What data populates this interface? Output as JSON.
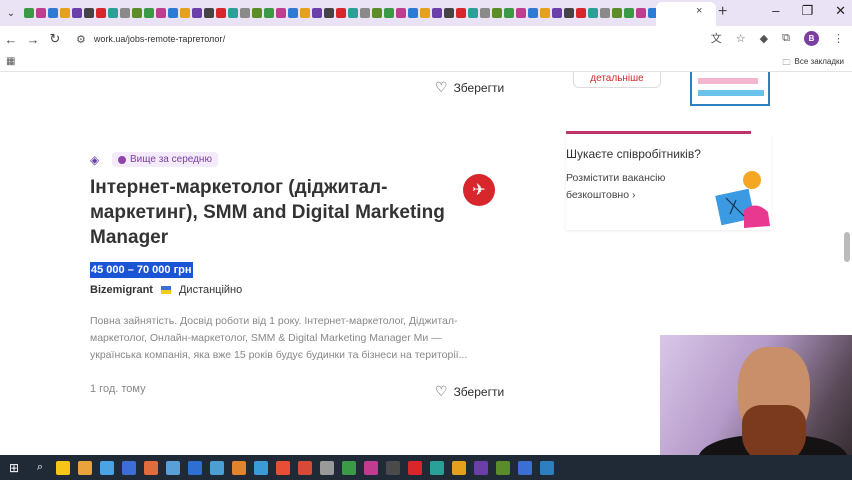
{
  "browser": {
    "tab_close": "×",
    "tab_new": "+",
    "url": "work.ua/jobs-remote-таргетолог/",
    "avatar_letter": "B",
    "all_bookmarks": "Все закладки"
  },
  "listing_top": {
    "save_label": "Зберегти"
  },
  "job": {
    "badge_label": "Вище за середню",
    "title": "Інтернет-маркетолог (діджитал-маркетинг), SMM and Digital Marketing Manager",
    "salary": "45 000 – 70 000 грн",
    "company": "Bizemigrant",
    "work_mode": "Дистанційно",
    "description": "Повна зайнятість. Досвід роботи від 1 року. Інтернет-маркетолог, Діджитал-маркетолог, Онлайн-маркетолог, SMM & Digital Marketing Manager Ми — українська компанія, яка вже 15 років будує будинки та бізнеси на території...",
    "posted": "1 год. тому",
    "save_label": "Зберегти"
  },
  "sidebar": {
    "top_button": "детальніше",
    "employer_title": "Шукаєте співробітників?",
    "employer_link": "Розмістити вакансію безкоштовно ›"
  },
  "colors": {
    "accent_purple": "#7b3fa0",
    "salary_highlight": "#1a55d6",
    "divider_pink": "#c2336b",
    "logo_red": "#d7262c"
  }
}
